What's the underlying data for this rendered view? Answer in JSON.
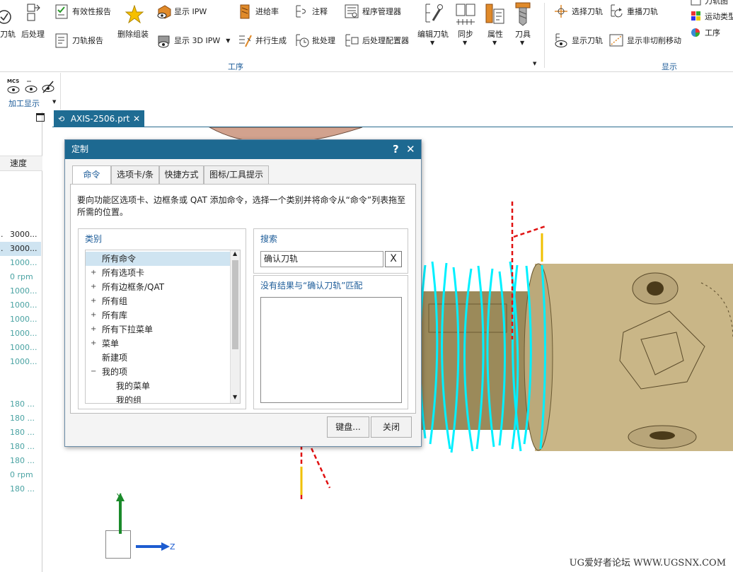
{
  "ribbon": {
    "col1_label": "刀轨",
    "col2_label": "后处理",
    "item_validity_report": "有效性报告",
    "item_toolpath_report": "刀轨报告",
    "item_delete_group": "删除组装",
    "item_show_ipw": "显示 IPW",
    "item_show_3d_ipw": "显示 3D IPW",
    "item_feedrate": "进给率",
    "item_parallel_generate": "并行生成",
    "item_annotation": "注释",
    "item_batch": "批处理",
    "item_program_manager": "程序管理器",
    "item_postprocessor_config": "后处理配置器",
    "item_edit_toolpath": "编辑刀轨",
    "item_sync": "同步",
    "item_properties": "属性",
    "item_tool": "刀具",
    "group_operation": "工序",
    "item_select_toolpath": "选择刀轨",
    "item_replay_toolpath": "重播刀轨",
    "item_show_toolpath": "显示刀轨",
    "item_show_noncut_move": "显示非切削移动",
    "item_toolpath_partial": "刀轨图",
    "item_motion_type_partial": "运动类型",
    "item_operation_right": "工序",
    "group_display": "显示"
  },
  "quick_section": {
    "label": "加工显示",
    "mcs_text": "MCS"
  },
  "left_table": {
    "header": "速度",
    "rows": [
      {
        "text": "3000...",
        "dim": false,
        "selected": false
      },
      {
        "text": "3000...",
        "dim": false,
        "selected": true
      },
      {
        "text": "1000...",
        "dim": true,
        "selected": false
      },
      {
        "text": "0 rpm",
        "dim": true,
        "selected": false
      },
      {
        "text": "1000...",
        "dim": true,
        "selected": false
      },
      {
        "text": "1000...",
        "dim": true,
        "selected": false
      },
      {
        "text": "1000...",
        "dim": true,
        "selected": false
      },
      {
        "text": "1000...",
        "dim": true,
        "selected": false
      },
      {
        "text": "1000...",
        "dim": true,
        "selected": false
      },
      {
        "text": "1000...",
        "dim": true,
        "selected": false
      },
      {
        "text": "",
        "dim": true,
        "selected": false
      },
      {
        "text": "",
        "dim": true,
        "selected": false
      },
      {
        "text": "180 ...",
        "dim": true,
        "selected": false
      },
      {
        "text": "180 ...",
        "dim": true,
        "selected": false
      },
      {
        "text": "180 ...",
        "dim": true,
        "selected": false
      },
      {
        "text": "180 ...",
        "dim": true,
        "selected": false
      },
      {
        "text": "180 ...",
        "dim": true,
        "selected": false
      },
      {
        "text": "0 rpm",
        "dim": true,
        "selected": false
      },
      {
        "text": "180 ...",
        "dim": true,
        "selected": false
      }
    ]
  },
  "file_tab": {
    "name": "AXIS-2506.prt"
  },
  "dialog": {
    "title": "定制",
    "help": "?",
    "close": "✕",
    "tabs": [
      "命令",
      "选项卡/条",
      "快捷方式",
      "图标/工具提示"
    ],
    "instruction": "要向功能区选项卡、边框条或 QAT 添加命令，选择一个类别并将命令从“命令”列表拖至所需的位置。",
    "category_label": "类别",
    "tree": [
      {
        "label": "所有命令",
        "expander": "",
        "selected": true,
        "indent": 0
      },
      {
        "label": "所有选项卡",
        "expander": "+",
        "selected": false,
        "indent": 0
      },
      {
        "label": "所有边框条/QAT",
        "expander": "+",
        "selected": false,
        "indent": 0
      },
      {
        "label": "所有组",
        "expander": "+",
        "selected": false,
        "indent": 0
      },
      {
        "label": "所有库",
        "expander": "+",
        "selected": false,
        "indent": 0
      },
      {
        "label": "所有下拉菜单",
        "expander": "+",
        "selected": false,
        "indent": 0
      },
      {
        "label": "菜单",
        "expander": "+",
        "selected": false,
        "indent": 0
      },
      {
        "label": "新建项",
        "expander": "",
        "selected": false,
        "indent": 0
      },
      {
        "label": "我的项",
        "expander": "−",
        "selected": false,
        "indent": 0
      },
      {
        "label": "我的菜单",
        "expander": "",
        "selected": false,
        "indent": 1
      },
      {
        "label": "我的组",
        "expander": "",
        "selected": false,
        "indent": 1
      }
    ],
    "search_label": "搜索",
    "search_value": "确认刀轨",
    "search_clear": "X",
    "no_result": "没有结果与“确认刀轨”匹配",
    "keyboard_button": "键盘...",
    "close_button": "关闭"
  },
  "axes": {
    "y": "Y",
    "z": "Z"
  },
  "watermark": "UG爱好者论坛 WWW.UGSNX.COM"
}
